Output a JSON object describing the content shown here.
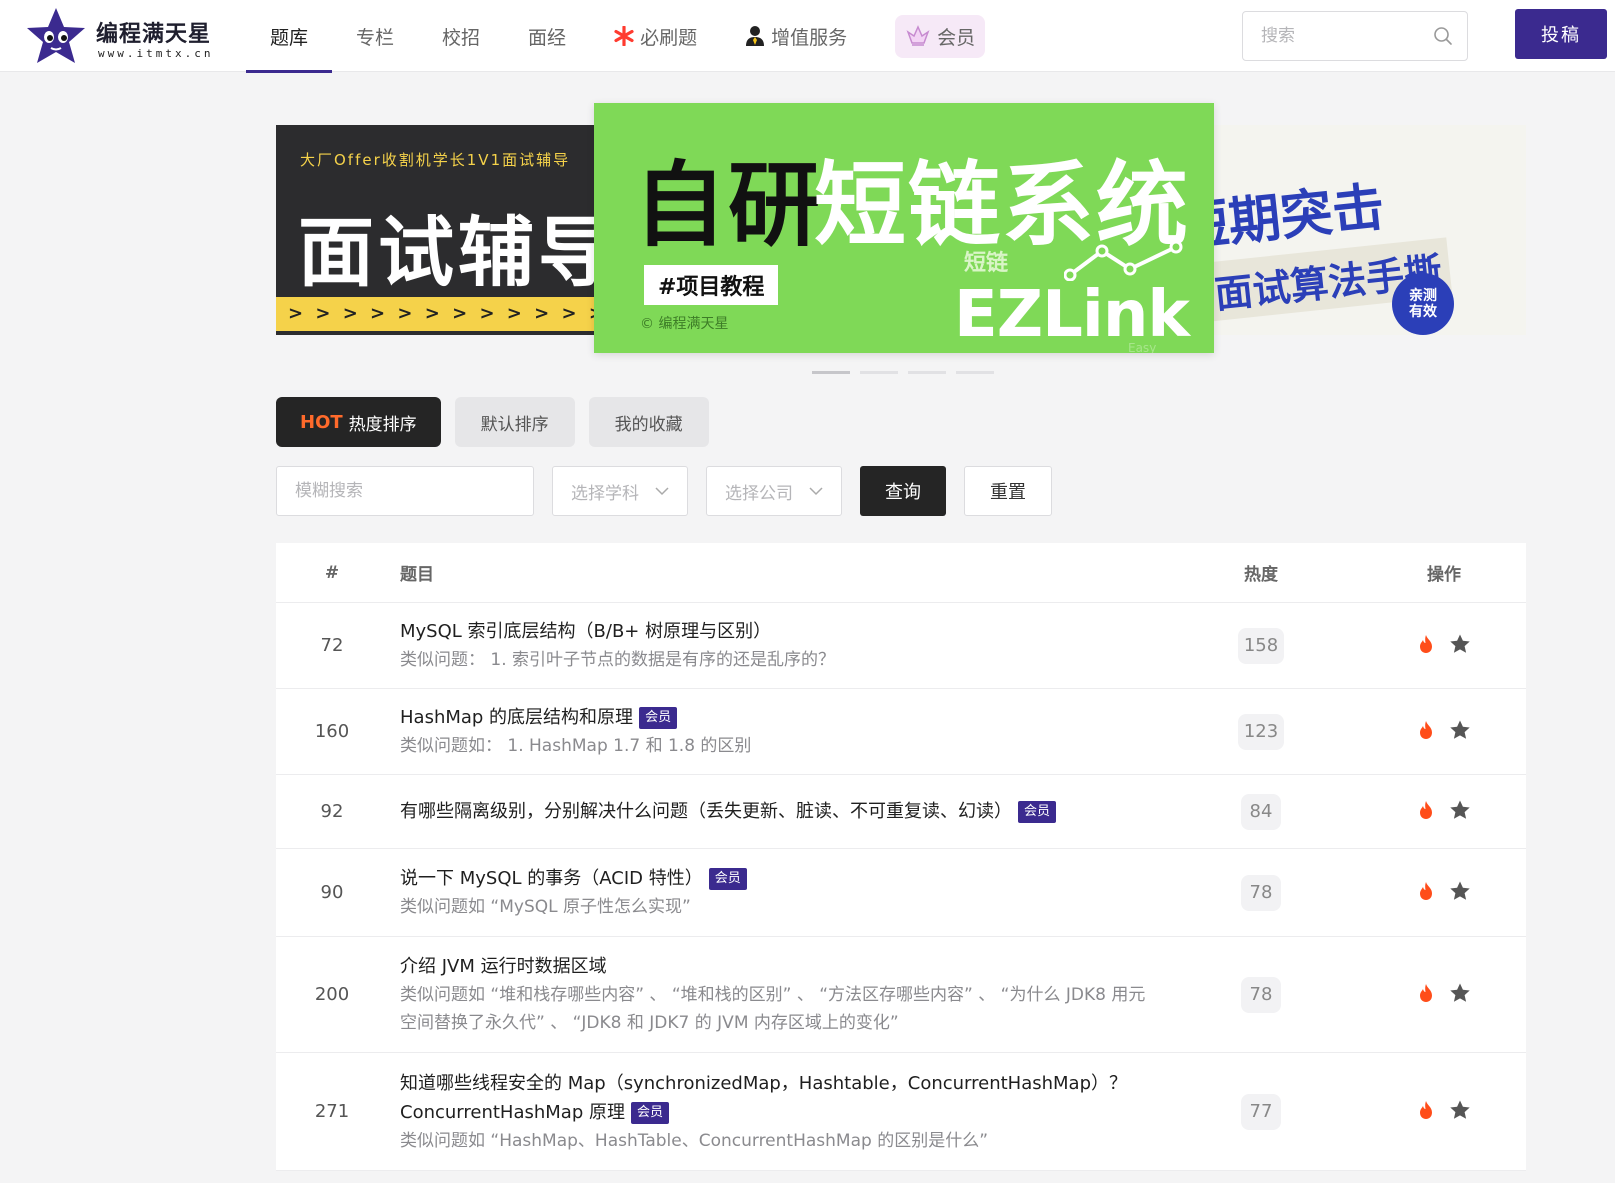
{
  "brand": {
    "name": "编程满天星",
    "url": "www.itmtx.cn"
  },
  "nav": [
    {
      "label": "题库",
      "active": true
    },
    {
      "label": "专栏"
    },
    {
      "label": "校招"
    },
    {
      "label": "面经"
    },
    {
      "label": "必刷题",
      "icon": "asterisk-icon"
    },
    {
      "label": "增值服务",
      "icon": "user-tie-icon"
    },
    {
      "label": "会员",
      "icon": "crown-icon"
    }
  ],
  "header": {
    "search_placeholder": "搜索",
    "submit_label": "投稿"
  },
  "banner": {
    "left": {
      "top": "大厂Offer收割机学长1V1面试辅导",
      "big": "面试辅导",
      "stripe": "> > > > > > > > > > > > > > >"
    },
    "center": {
      "title_a": "自研",
      "title_b": "短链系统",
      "tag": "#项目教程",
      "copyright": "© 编程满天星",
      "small": "短链",
      "brand": "EZLink",
      "easy": "Easy"
    },
    "right": {
      "title": "短期突击",
      "sub": "面试算法手撕",
      "badge_a": "亲测",
      "badge_b": "有效"
    }
  },
  "sort_tabs": [
    {
      "hot_mark": "HOT",
      "label": "热度排序",
      "active": true
    },
    {
      "label": "默认排序"
    },
    {
      "label": "我的收藏"
    }
  ],
  "filters": {
    "fuzzy_placeholder": "模糊搜索",
    "subject_placeholder": "选择学科",
    "company_placeholder": "选择公司",
    "query_label": "查询",
    "reset_label": "重置"
  },
  "table": {
    "headers": {
      "num": "#",
      "title": "题目",
      "hot": "热度",
      "ops": "操作"
    },
    "rows": [
      {
        "num": "72",
        "title": "MySQL 索引底层结构（B/B+ 树原理与区别）",
        "vip": "",
        "sub": "类似问题：  1. 索引叶子节点的数据是有序的还是乱序的？",
        "heat": "158",
        "height": 86
      },
      {
        "num": "160",
        "title": "HashMap 的底层结构和原理",
        "vip": "会员",
        "sub": "类似问题如：  1. HashMap 1.7 和 1.8 的区别",
        "heat": "123",
        "height": 86
      },
      {
        "num": "92",
        "title": "有哪些隔离级别，分别解决什么问题（丢失更新、脏读、不可重复读、幻读）",
        "vip": "会员",
        "sub": "",
        "heat": "84",
        "height": 74
      },
      {
        "num": "90",
        "title": "说一下 MySQL 的事务（ACID 特性）",
        "vip": "会员",
        "sub": "类似问题如 “MySQL 原子性怎么实现”",
        "heat": "78",
        "height": 88
      },
      {
        "num": "200",
        "title": "介绍 JVM 运行时数据区域",
        "vip": "",
        "sub": "类似问题如 “堆和栈存哪些内容” 、 “堆和栈的区别” 、 “方法区存哪些内容” 、 “为什么 JDK8 用元空间替换了永久代” 、 “JDK8 和 JDK7 的 JVM 内存区域上的变化”",
        "heat": "78",
        "height": 116
      },
      {
        "num": "271",
        "title": "知道哪些线程安全的 Map（synchronizedMap，Hashtable，ConcurrentHashMap）？ConcurrentHashMap 原理",
        "vip": "会员",
        "sub": "类似问题如 “HashMap、HashTable、ConcurrentHashMap 的区别是什么”",
        "heat": "77",
        "height": 118
      }
    ]
  },
  "colors": {
    "accent": "#3b2a8f",
    "fire": "#ff4d1a",
    "star": "#555555",
    "banner_green": "#7fd957"
  }
}
